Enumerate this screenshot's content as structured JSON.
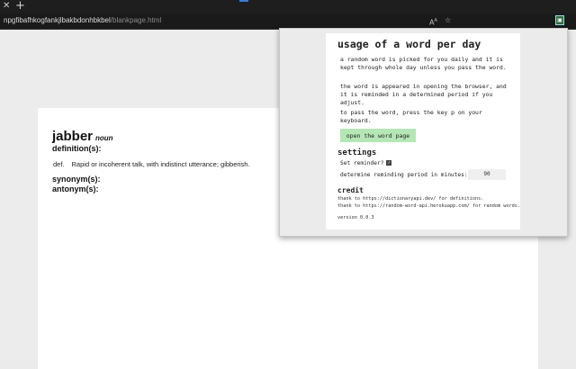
{
  "browser": {
    "tab_close_glyph": "✕",
    "new_tab_glyph": "+",
    "url_host": "npgfibafhkogfankjlbakbdonhbkbel",
    "url_path": "/blankpage.html",
    "icons": [
      "read-aloud-icon",
      "favorites-icon",
      "extension-icon"
    ]
  },
  "dictionary": {
    "word": "jabber",
    "part_of_speech": "noun",
    "definition_heading": "definition(s):",
    "definition_abbr": "def.",
    "definition_text": "Rapid or incoherent talk, with indistinct utterance; gibberish.",
    "synonym_heading": "synonym(s):",
    "antonym_heading": "antonym(s):"
  },
  "popup": {
    "title": "usage of a word per day",
    "para1": "a random word is picked for you daily and it is kept through whole day unless you pass the word.",
    "para2": "the word is appeared in opening the browser, and it is reminded in a determined period if you adjust.",
    "para3": "to pass the word, press the key p on your keyboard.",
    "open_button": "open the word page",
    "settings_heading": "settings",
    "reminder_label": "Set reminder?",
    "reminder_checked": true,
    "period_label": "determine reminding period in minutes:",
    "period_value": "90",
    "credit_heading": "credit",
    "credit1": "thank to https://dictionaryapi.dev/ for definitions.",
    "credit2": "thank to https://random-word-api.herokuapp.com/ for random words.",
    "version": "version 0.0.3"
  },
  "colors": {
    "button_green": "#b5e6b5",
    "tab_accent": "#3a7bd5"
  }
}
